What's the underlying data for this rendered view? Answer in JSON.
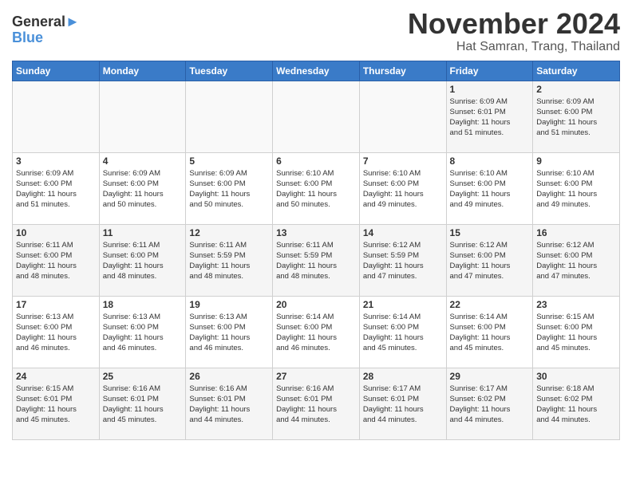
{
  "header": {
    "logo_line1": "General",
    "logo_line2": "Blue",
    "month": "November 2024",
    "location": "Hat Samran, Trang, Thailand"
  },
  "weekdays": [
    "Sunday",
    "Monday",
    "Tuesday",
    "Wednesday",
    "Thursday",
    "Friday",
    "Saturday"
  ],
  "weeks": [
    [
      {
        "day": "",
        "info": ""
      },
      {
        "day": "",
        "info": ""
      },
      {
        "day": "",
        "info": ""
      },
      {
        "day": "",
        "info": ""
      },
      {
        "day": "",
        "info": ""
      },
      {
        "day": "1",
        "info": "Sunrise: 6:09 AM\nSunset: 6:01 PM\nDaylight: 11 hours\nand 51 minutes."
      },
      {
        "day": "2",
        "info": "Sunrise: 6:09 AM\nSunset: 6:00 PM\nDaylight: 11 hours\nand 51 minutes."
      }
    ],
    [
      {
        "day": "3",
        "info": "Sunrise: 6:09 AM\nSunset: 6:00 PM\nDaylight: 11 hours\nand 51 minutes."
      },
      {
        "day": "4",
        "info": "Sunrise: 6:09 AM\nSunset: 6:00 PM\nDaylight: 11 hours\nand 50 minutes."
      },
      {
        "day": "5",
        "info": "Sunrise: 6:09 AM\nSunset: 6:00 PM\nDaylight: 11 hours\nand 50 minutes."
      },
      {
        "day": "6",
        "info": "Sunrise: 6:10 AM\nSunset: 6:00 PM\nDaylight: 11 hours\nand 50 minutes."
      },
      {
        "day": "7",
        "info": "Sunrise: 6:10 AM\nSunset: 6:00 PM\nDaylight: 11 hours\nand 49 minutes."
      },
      {
        "day": "8",
        "info": "Sunrise: 6:10 AM\nSunset: 6:00 PM\nDaylight: 11 hours\nand 49 minutes."
      },
      {
        "day": "9",
        "info": "Sunrise: 6:10 AM\nSunset: 6:00 PM\nDaylight: 11 hours\nand 49 minutes."
      }
    ],
    [
      {
        "day": "10",
        "info": "Sunrise: 6:11 AM\nSunset: 6:00 PM\nDaylight: 11 hours\nand 48 minutes."
      },
      {
        "day": "11",
        "info": "Sunrise: 6:11 AM\nSunset: 6:00 PM\nDaylight: 11 hours\nand 48 minutes."
      },
      {
        "day": "12",
        "info": "Sunrise: 6:11 AM\nSunset: 5:59 PM\nDaylight: 11 hours\nand 48 minutes."
      },
      {
        "day": "13",
        "info": "Sunrise: 6:11 AM\nSunset: 5:59 PM\nDaylight: 11 hours\nand 48 minutes."
      },
      {
        "day": "14",
        "info": "Sunrise: 6:12 AM\nSunset: 5:59 PM\nDaylight: 11 hours\nand 47 minutes."
      },
      {
        "day": "15",
        "info": "Sunrise: 6:12 AM\nSunset: 6:00 PM\nDaylight: 11 hours\nand 47 minutes."
      },
      {
        "day": "16",
        "info": "Sunrise: 6:12 AM\nSunset: 6:00 PM\nDaylight: 11 hours\nand 47 minutes."
      }
    ],
    [
      {
        "day": "17",
        "info": "Sunrise: 6:13 AM\nSunset: 6:00 PM\nDaylight: 11 hours\nand 46 minutes."
      },
      {
        "day": "18",
        "info": "Sunrise: 6:13 AM\nSunset: 6:00 PM\nDaylight: 11 hours\nand 46 minutes."
      },
      {
        "day": "19",
        "info": "Sunrise: 6:13 AM\nSunset: 6:00 PM\nDaylight: 11 hours\nand 46 minutes."
      },
      {
        "day": "20",
        "info": "Sunrise: 6:14 AM\nSunset: 6:00 PM\nDaylight: 11 hours\nand 46 minutes."
      },
      {
        "day": "21",
        "info": "Sunrise: 6:14 AM\nSunset: 6:00 PM\nDaylight: 11 hours\nand 45 minutes."
      },
      {
        "day": "22",
        "info": "Sunrise: 6:14 AM\nSunset: 6:00 PM\nDaylight: 11 hours\nand 45 minutes."
      },
      {
        "day": "23",
        "info": "Sunrise: 6:15 AM\nSunset: 6:00 PM\nDaylight: 11 hours\nand 45 minutes."
      }
    ],
    [
      {
        "day": "24",
        "info": "Sunrise: 6:15 AM\nSunset: 6:01 PM\nDaylight: 11 hours\nand 45 minutes."
      },
      {
        "day": "25",
        "info": "Sunrise: 6:16 AM\nSunset: 6:01 PM\nDaylight: 11 hours\nand 45 minutes."
      },
      {
        "day": "26",
        "info": "Sunrise: 6:16 AM\nSunset: 6:01 PM\nDaylight: 11 hours\nand 44 minutes."
      },
      {
        "day": "27",
        "info": "Sunrise: 6:16 AM\nSunset: 6:01 PM\nDaylight: 11 hours\nand 44 minutes."
      },
      {
        "day": "28",
        "info": "Sunrise: 6:17 AM\nSunset: 6:01 PM\nDaylight: 11 hours\nand 44 minutes."
      },
      {
        "day": "29",
        "info": "Sunrise: 6:17 AM\nSunset: 6:02 PM\nDaylight: 11 hours\nand 44 minutes."
      },
      {
        "day": "30",
        "info": "Sunrise: 6:18 AM\nSunset: 6:02 PM\nDaylight: 11 hours\nand 44 minutes."
      }
    ]
  ]
}
